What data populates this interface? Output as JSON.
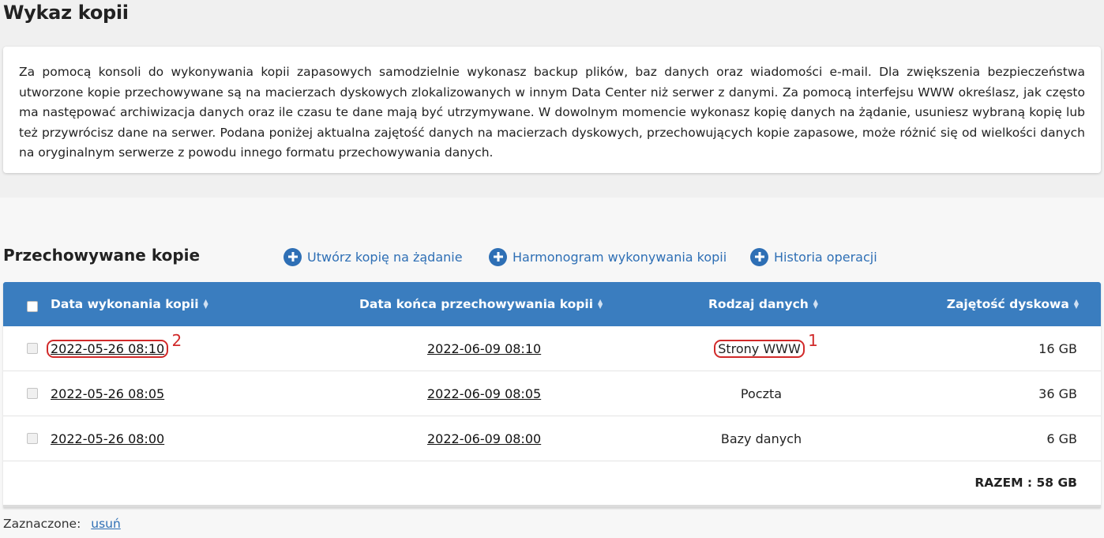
{
  "page": {
    "title": "Wykaz kopii",
    "intro": "Za pomocą konsoli do wykonywania kopii zapasowych samodzielnie wykonasz backup plików, baz danych oraz wiadomości e-mail. Dla zwiększenia bezpieczeństwa utworzone kopie przechowywane są na macierzach dyskowych zlokalizowanych w innym Data Center niż serwer z danymi. Za pomocą interfejsu WWW określasz, jak często ma następować archiwizacja danych oraz ile czasu te dane mają być utrzymywane. W dowolnym momencie wykonasz kopię danych na żądanie, usuniesz wybraną kopię lub też przywrócisz dane na serwer. Podana poniżej aktualna zajętość danych na macierzach dyskowych, przechowujących kopie zapasowe, może różnić się od wielkości danych na oryginalnym serwerze z powodu innego formatu przechowywania danych."
  },
  "section": {
    "title": "Przechowywane kopie",
    "actions": [
      {
        "label": "Utwórz kopię na żądanie",
        "icon": "plus-circle-icon"
      },
      {
        "label": "Harmonogram wykonywania kopii",
        "icon": "plus-circle-icon"
      },
      {
        "label": "Historia operacji",
        "icon": "plus-circle-icon"
      }
    ]
  },
  "table": {
    "headers": {
      "date": "Data wykonania kopii",
      "end": "Data końca przechowywania kopii",
      "type": "Rodzaj danych",
      "size": "Zajętość dyskowa"
    },
    "rows": [
      {
        "date": "2022-05-26 08:10",
        "end": "2022-06-09 08:10",
        "type": "Strony WWW",
        "size": "16 GB"
      },
      {
        "date": "2022-05-26 08:05",
        "end": "2022-06-09 08:05",
        "type": "Poczta",
        "size": "36 GB"
      },
      {
        "date": "2022-05-26 08:00",
        "end": "2022-06-09 08:00",
        "type": "Bazy danych",
        "size": "6 GB"
      }
    ],
    "total": "RAZEM : 58 GB"
  },
  "annotations": {
    "mark_type": "1",
    "mark_date": "2"
  },
  "footer": {
    "selected_label": "Zaznaczone:",
    "delete_label": "usuń"
  },
  "colors": {
    "header_bg": "#3a7dbf",
    "link": "#2e6fb5",
    "annotation": "#d12a2a"
  }
}
